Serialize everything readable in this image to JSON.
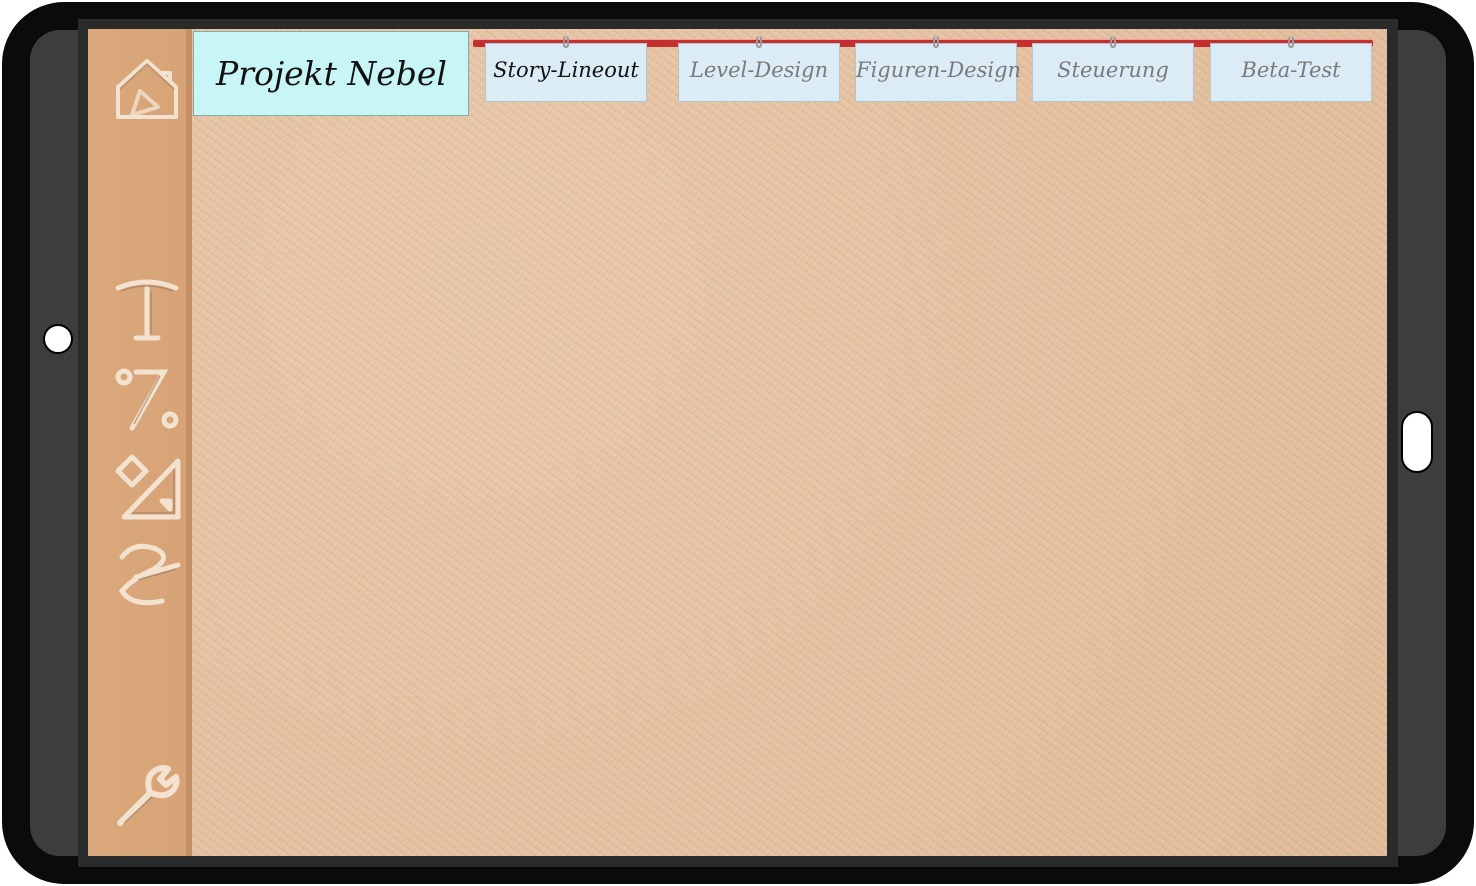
{
  "project": {
    "title": "Projekt Nebel"
  },
  "tabs": [
    {
      "label": "Story-Lineout",
      "active": true
    },
    {
      "label": "Level-Design",
      "active": false
    },
    {
      "label": "Figuren-Design",
      "active": false
    },
    {
      "label": "Steuerung",
      "active": false
    },
    {
      "label": "Beta-Test",
      "active": false
    }
  ],
  "sidebar": {
    "icons": [
      "home-icon",
      "text-tool-icon",
      "percent-icon",
      "shapes-icon",
      "draw-icon",
      "wrench-icon"
    ]
  },
  "colors": {
    "canvas": "#e6c3a3",
    "sidebar": "#d8a57a",
    "title_card": "#c8f6f6",
    "tab_rail": "#c62f2f",
    "tab": "#dcecf6",
    "icon_stroke": "#f3e2cf"
  }
}
